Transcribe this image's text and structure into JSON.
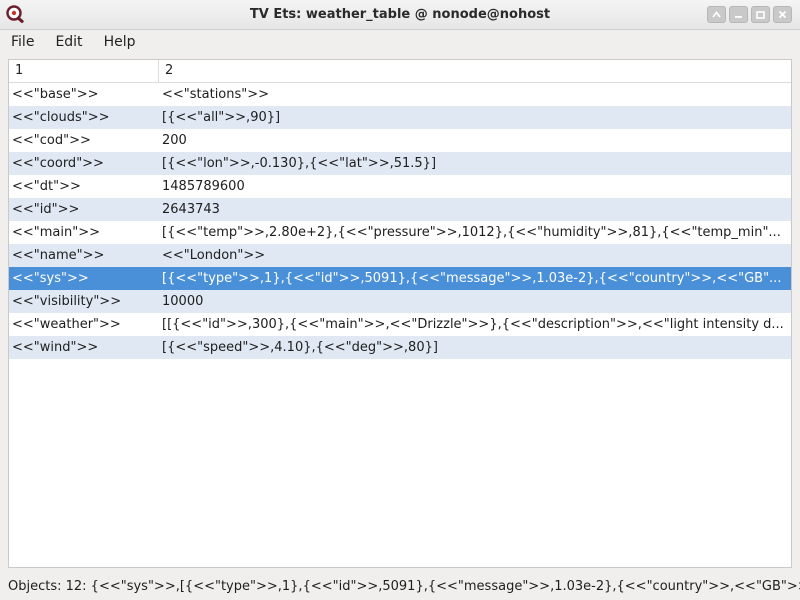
{
  "window": {
    "title": "TV Ets: weather_table @ nonode@nohost"
  },
  "menu": {
    "items": [
      "File",
      "Edit",
      "Help"
    ]
  },
  "table": {
    "columns": [
      "1",
      "2"
    ],
    "rows": [
      {
        "key": "<<\"base\">>",
        "value": "<<\"stations\">>"
      },
      {
        "key": "<<\"clouds\">>",
        "value": "[{<<\"all\">>,90}]"
      },
      {
        "key": "<<\"cod\">>",
        "value": "200"
      },
      {
        "key": "<<\"coord\">>",
        "value": "[{<<\"lon\">>,-0.130},{<<\"lat\">>,51.5}]"
      },
      {
        "key": "<<\"dt\">>",
        "value": "1485789600"
      },
      {
        "key": "<<\"id\">>",
        "value": "2643743"
      },
      {
        "key": "<<\"main\">>",
        "value": "[{<<\"temp\">>,2.80e+2},{<<\"pressure\">>,1012},{<<\"humidity\">>,81},{<<\"temp_min\"..."
      },
      {
        "key": "<<\"name\">>",
        "value": "<<\"London\">>"
      },
      {
        "key": "<<\"sys\">>",
        "value": "[{<<\"type\">>,1},{<<\"id\">>,5091},{<<\"message\">>,1.03e-2},{<<\"country\">>,<<\"GB\"..."
      },
      {
        "key": "<<\"visibility\">>",
        "value": "10000"
      },
      {
        "key": "<<\"weather\">>",
        "value": "[[{<<\"id\">>,300},{<<\"main\">>,<<\"Drizzle\">>},{<<\"description\">>,<<\"light intensity d..."
      },
      {
        "key": "<<\"wind\">>",
        "value": "[{<<\"speed\">>,4.10},{<<\"deg\">>,80}]"
      }
    ],
    "selected_index": 8
  },
  "status": {
    "text": "Objects: 12: {<<\"sys\">>,[{<<\"type\">>,1},{<<\"id\">>,5091},{<<\"message\">>,1.03e-2},{<<\"country\">>,<<\"GB\">>"
  },
  "colors": {
    "selection": "#4a90d9",
    "alt_row": "#dfe8f3"
  }
}
